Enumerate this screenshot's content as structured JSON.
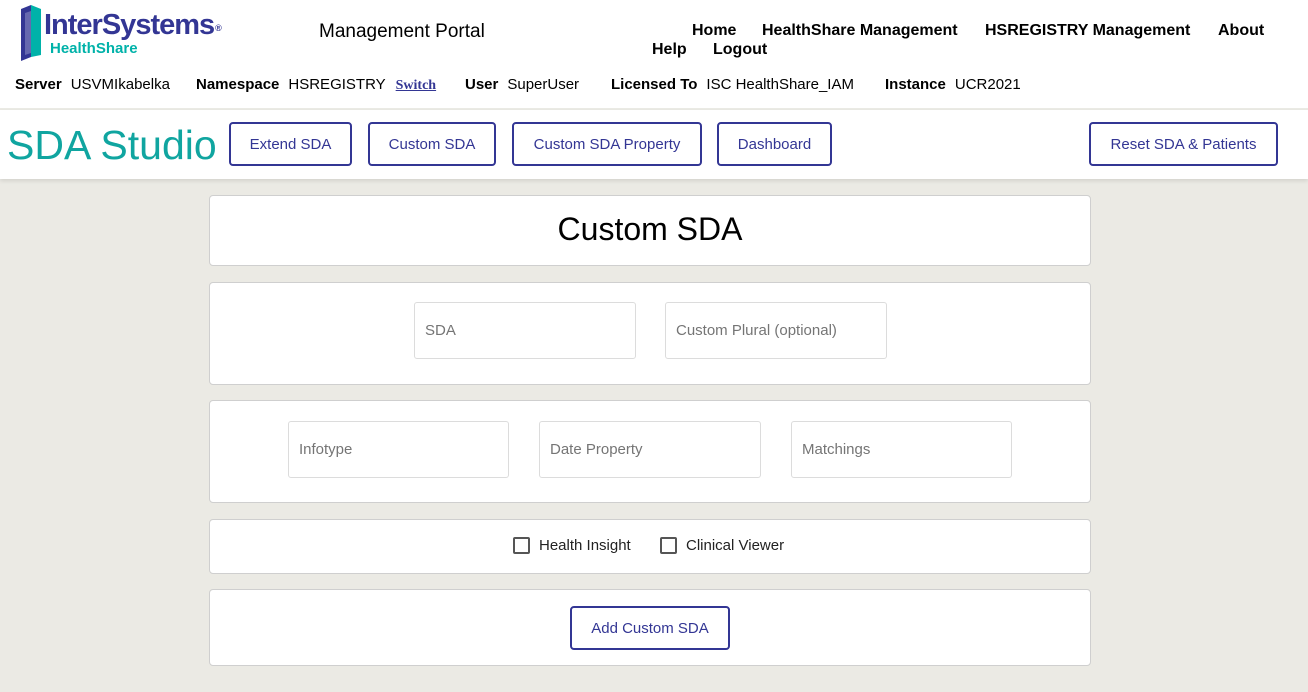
{
  "logo": {
    "brand": "InterSystems",
    "product": "HealthShare",
    "mark": "®"
  },
  "portal": {
    "title": "Management Portal"
  },
  "nav": {
    "home": "Home",
    "healthshare_management": "HealthShare Management",
    "hsregistry_management": "HSREGISTRY Management",
    "about": "About",
    "help": "Help",
    "logout": "Logout"
  },
  "info": {
    "server_label": "Server",
    "server_value": "USVMIkabelka",
    "namespace_label": "Namespace",
    "namespace_value": "HSREGISTRY",
    "switch": "Switch",
    "user_label": "User",
    "user_value": "SuperUser",
    "licensed_label": "Licensed To",
    "licensed_value": "ISC HealthShare_IAM",
    "instance_label": "Instance",
    "instance_value": "UCR2021"
  },
  "studio": {
    "title": "SDA Studio",
    "buttons": {
      "extend_sda": "Extend SDA",
      "custom_sda": "Custom SDA",
      "custom_sda_property": "Custom SDA Property",
      "dashboard": "Dashboard",
      "reset": "Reset SDA & Patients"
    }
  },
  "form": {
    "heading": "Custom SDA",
    "sda": {
      "placeholder": "SDA",
      "value": ""
    },
    "custom_plural": {
      "placeholder": "Custom Plural (optional)",
      "value": ""
    },
    "infotype": {
      "placeholder": "Infotype",
      "value": ""
    },
    "date_property": {
      "placeholder": "Date Property",
      "value": ""
    },
    "matchings": {
      "placeholder": "Matchings",
      "value": ""
    },
    "health_insight": {
      "label": "Health Insight",
      "checked": false
    },
    "clinical_viewer": {
      "label": "Clinical Viewer",
      "checked": false
    },
    "submit": "Add Custom SDA"
  },
  "colors": {
    "brand_navy": "#333694",
    "brand_teal": "#00b2a9",
    "studio_title": "#10a5a0",
    "page_background": "#ebeae4"
  }
}
